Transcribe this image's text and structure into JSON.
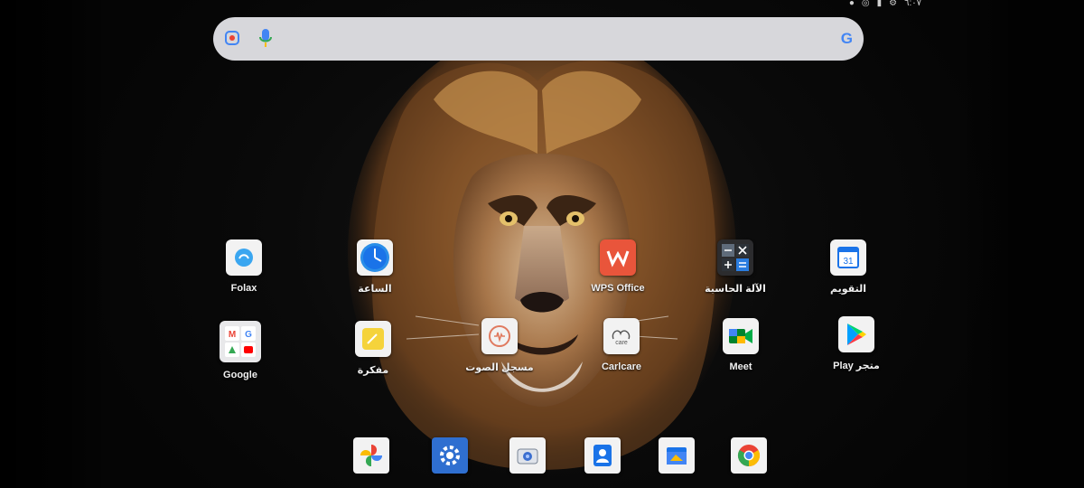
{
  "status_bar": {
    "time": "٦:٠٧"
  },
  "search": {
    "placeholder": "",
    "g_letter": "G"
  },
  "apps": [
    {
      "name": "Folax",
      "icon": "folax-icon"
    },
    {
      "name": "الساعة",
      "icon": "clock-icon"
    },
    {
      "name": "WPS Office",
      "icon": "wps-office-icon"
    },
    {
      "name": "الآلة الحاسبة",
      "icon": "calculator-icon"
    },
    {
      "name": "التقويم",
      "icon": "calendar-icon"
    },
    {
      "name": "Google",
      "icon": "google-folder-icon"
    },
    {
      "name": "مفكرة",
      "icon": "notes-icon"
    },
    {
      "name": "مسجل الصوت",
      "icon": "voice-recorder-icon"
    },
    {
      "name": "Carlcare",
      "icon": "carlcare-icon"
    },
    {
      "name": "Meet",
      "icon": "meet-icon"
    },
    {
      "name": "Play متجر",
      "icon": "play-store-icon"
    }
  ],
  "calendar_day": "31",
  "dock": [
    "photos-icon",
    "settings-icon",
    "camera-icon",
    "contacts-icon",
    "files-icon",
    "chrome-icon"
  ],
  "colors": {
    "wps": "#e9553b",
    "settings": "#2f6fd0",
    "search_bg": "#d7d7db"
  }
}
